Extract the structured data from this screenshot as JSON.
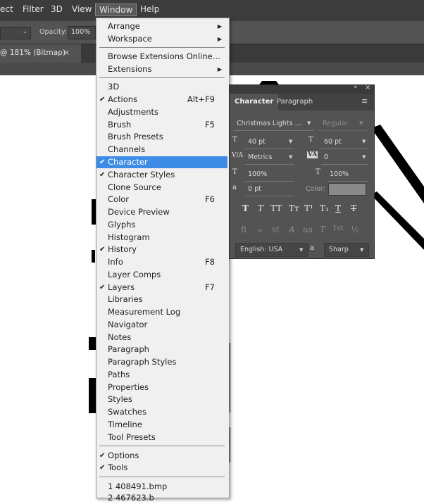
{
  "menubar": {
    "items": [
      "ect",
      "Filter",
      "3D",
      "View",
      "Window",
      "Help"
    ]
  },
  "options": {
    "opacity_label": "Opacity:",
    "opacity_value": "100%"
  },
  "document": {
    "tab_label": "@ 181% (Bitmap)",
    "close_glyph": "×"
  },
  "window_menu": {
    "items": {
      "arrange": "Arrange",
      "workspace": "Workspace",
      "browse_ext": "Browse Extensions Online...",
      "extensions": "Extensions",
      "i3d": "3D",
      "actions": "Actions",
      "actions_sc": "Alt+F9",
      "adjustments": "Adjustments",
      "brush": "Brush",
      "brush_sc": "F5",
      "brush_presets": "Brush Presets",
      "channels": "Channels",
      "character": "Character",
      "character_styles": "Character Styles",
      "clone_source": "Clone Source",
      "color": "Color",
      "color_sc": "F6",
      "device_preview": "Device Preview",
      "glyphs": "Glyphs",
      "histogram": "Histogram",
      "history": "History",
      "info": "Info",
      "info_sc": "F8",
      "layer_comps": "Layer Comps",
      "layers": "Layers",
      "layers_sc": "F7",
      "libraries": "Libraries",
      "measurement_log": "Measurement Log",
      "navigator": "Navigator",
      "notes": "Notes",
      "paragraph": "Paragraph",
      "paragraph_styles": "Paragraph Styles",
      "paths": "Paths",
      "properties": "Properties",
      "styles": "Styles",
      "swatches": "Swatches",
      "timeline": "Timeline",
      "tool_presets": "Tool Presets",
      "options": "Options",
      "tools": "Tools",
      "recent1": "1 408491.bmp",
      "recent2": "2 467623.b"
    },
    "check_glyph": "✔",
    "arrow_glyph": "▶"
  },
  "character_panel": {
    "tabs": {
      "character": "Character",
      "paragraph": "Paragraph"
    },
    "font_family": "Christmas Lights ...",
    "font_style": "Regular",
    "font_size": "40 pt",
    "leading": "60 pt",
    "kerning": "Metrics",
    "tracking": "0",
    "vertical_scale": "100%",
    "horizontal_scale": "100%",
    "baseline_shift": "0 pt",
    "color_label": "Color:",
    "color_value": "#8a8a8a",
    "language": "English: USA",
    "aa_label": "a",
    "antialias": "Sharp",
    "icon_labels": {
      "tt": "T",
      "tt_small": "T",
      "va": "V/A",
      "va2": "VA",
      "sub": "a"
    },
    "style_buttons": [
      "T",
      "T",
      "TT",
      "Tт",
      "T¹",
      "T₁",
      "T",
      "T"
    ],
    "opentype_buttons": [
      "fi",
      "ℴ",
      "st",
      "A",
      "aa",
      "T",
      "1st",
      "½"
    ],
    "collapse_glyph": "«",
    "close_glyph": "×",
    "menu_glyph": "≡"
  }
}
